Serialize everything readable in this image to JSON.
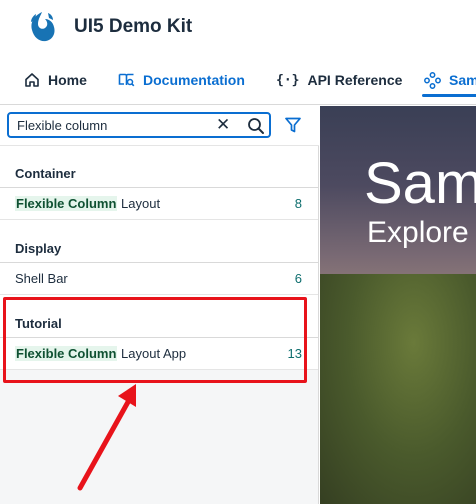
{
  "app": {
    "title": "UI5 Demo Kit",
    "logo": "bird-logo"
  },
  "tabs": [
    {
      "label": "Home",
      "icon": "home-icon",
      "active": false
    },
    {
      "label": "Documentation",
      "icon": "documentation-icon",
      "active": false
    },
    {
      "label": "API Reference",
      "icon": "api-icon",
      "active": false
    },
    {
      "label": "Sam",
      "icon": "samples-icon",
      "active": true
    }
  ],
  "search": {
    "value": "Flexible column",
    "clear_icon": "close-icon",
    "search_icon": "search-icon",
    "filter_icon": "filter-icon"
  },
  "groups": [
    {
      "title": "Container",
      "items": [
        {
          "highlight": "Flexible Column",
          "rest": " Layout",
          "count": "8"
        }
      ]
    },
    {
      "title": "Display",
      "items": [
        {
          "highlight": "",
          "rest": "Shell Bar",
          "count": "6"
        }
      ]
    },
    {
      "title": "Tutorial",
      "items": [
        {
          "highlight": "Flexible Column",
          "rest": " Layout App",
          "count": "13"
        }
      ]
    }
  ],
  "hero": {
    "title": "Sam",
    "subtitle": "Explore"
  },
  "colors": {
    "accent": "#0a6ed1",
    "highlight_bg": "#e5f5ec",
    "annotation": "#e8131b"
  }
}
